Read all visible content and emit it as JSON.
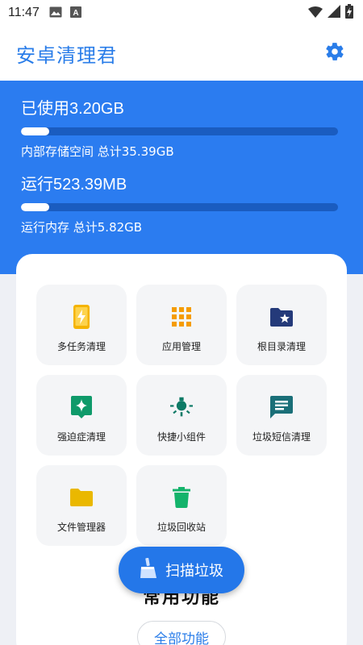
{
  "status_bar": {
    "time": "11:47",
    "left_icons": [
      "image-icon",
      "font-icon"
    ],
    "right_icons": [
      "wifi-icon",
      "signal-icon",
      "battery-icon"
    ]
  },
  "app_bar": {
    "title": "安卓清理君",
    "settings_icon": "gear-icon"
  },
  "storage": {
    "used_label": "已使用3.20GB",
    "detail": "内部存储空间 总计35.39GB",
    "fraction": 0.09
  },
  "memory": {
    "used_label": "运行523.39MB",
    "detail": "运行内存 总计5.82GB",
    "fraction": 0.088
  },
  "tools": [
    {
      "label": "多任务清理",
      "icon": "phone-charging-icon",
      "color": "#f5b400"
    },
    {
      "label": "应用管理",
      "icon": "apps-grid-icon",
      "color": "#f59c00"
    },
    {
      "label": "根目录清理",
      "icon": "folder-star-icon",
      "color": "#243a7a"
    },
    {
      "label": "强迫症清理",
      "icon": "sparkle-icon",
      "color": "#0f9a6a"
    },
    {
      "label": "快捷小组件",
      "icon": "lamp-icon",
      "color": "#0d7a66"
    },
    {
      "label": "垃圾短信清理",
      "icon": "sms-icon",
      "color": "#1a6f78"
    },
    {
      "label": "文件管理器",
      "icon": "folder-icon",
      "color": "#eab800"
    },
    {
      "label": "垃圾回收站",
      "icon": "trash-icon",
      "color": "#13b36b"
    }
  ],
  "section": {
    "title": "常用功能",
    "all_button": "全部功能"
  },
  "fab": {
    "label": "扫描垃圾",
    "icon": "broom-icon"
  },
  "colors": {
    "primary": "#2b7cf0",
    "title": "#2a7de9"
  }
}
